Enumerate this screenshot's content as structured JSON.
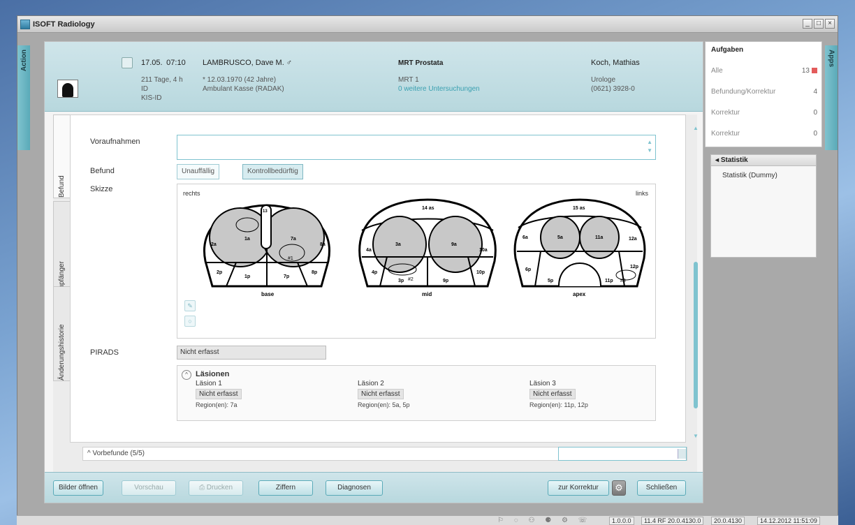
{
  "app": {
    "title": "ISOFT Radiology"
  },
  "side_tabs": {
    "left": "Action",
    "right": "Apps"
  },
  "patient": {
    "date": "17.05.",
    "time": "07:10",
    "name": "LAMBRUSCO, Dave M. ♂",
    "age_stay": "211 Tage, 4 h",
    "id_label": "ID",
    "kis_label": "KIS-ID",
    "birth": "* 12.03.1970 (42 Jahre)",
    "station": "Ambulant Kasse (RADAK)",
    "exam_title": "MRT Prostata",
    "exam_sub": "MRT 1",
    "exam_link": "0 weitere Untersuchungen",
    "doctor": "Koch, Mathias",
    "specialty": "Urologe",
    "phone": "(0621) 3928-0"
  },
  "vtabs": [
    "Befund",
    "Empfänger",
    "Änderungshistorie"
  ],
  "form": {
    "voraufnahmen_label": "Voraufnahmen",
    "befund_label": "Befund",
    "befund_options": [
      "Unauffällig",
      "Kontrollbedürftig"
    ],
    "skizze_label": "Skizze",
    "sketch_rechts": "rechts",
    "sketch_links": "links",
    "pirads_label": "PIRADS",
    "pirads_value": "Nicht erfasst"
  },
  "sketch_diagrams": [
    {
      "caption": "base",
      "zones": [
        "1a",
        "7a",
        "2a",
        "8a",
        "1p",
        "7p",
        "2p",
        "8p",
        "13"
      ],
      "marker": "#1"
    },
    {
      "caption": "mid",
      "zones": [
        "14 as",
        "3a",
        "9a",
        "4a",
        "10a",
        "3p",
        "9p",
        "4p",
        "10p"
      ],
      "marker": "#2"
    },
    {
      "caption": "apex",
      "zones": [
        "15 as",
        "5a",
        "11a",
        "6a",
        "12a",
        "5p",
        "11p",
        "6p",
        "12p"
      ],
      "marker": "#3"
    }
  ],
  "lesions": {
    "title": "Läsionen",
    "items": [
      {
        "name": "Läsion 1",
        "status": "Nicht erfasst",
        "region": "Region(en): 7a"
      },
      {
        "name": "Läsion 2",
        "status": "Nicht erfasst",
        "region": "Region(en): 5a, 5p"
      },
      {
        "name": "Läsion 3",
        "status": "Nicht erfasst",
        "region": "Region(en): 11p, 12p"
      }
    ]
  },
  "vorbefunde": {
    "label": "Vorbefunde (5/5)"
  },
  "footer": {
    "bilder": "Bilder öffnen",
    "vorschau": "Vorschau",
    "drucken": "Drucken",
    "ziffern": "Ziffern",
    "diagnosen": "Diagnosen",
    "zur_korrektur": "zur Korrektur",
    "schliessen": "Schließen"
  },
  "tasks": {
    "title": "Aufgaben",
    "rows": [
      {
        "label": "Alle",
        "count": "13"
      },
      {
        "label": "Befundung/Korrektur",
        "count": "4"
      },
      {
        "label": "Korrektur",
        "count": "0"
      },
      {
        "label": "Korrektur",
        "count": "0"
      }
    ]
  },
  "statistik": {
    "title": "Statistik",
    "body": "Statistik (Dummy)"
  },
  "statusbar": {
    "version": "1.0.0.0",
    "build": "11.4 RF 20.0.4130.0",
    "build2": "20.0.4130",
    "datetime": "14.12.2012 11:51:09"
  },
  "colors": {
    "accent": "#7fc3cf",
    "header_bg": "#c4dfe4",
    "alert": "#e35b5b"
  }
}
